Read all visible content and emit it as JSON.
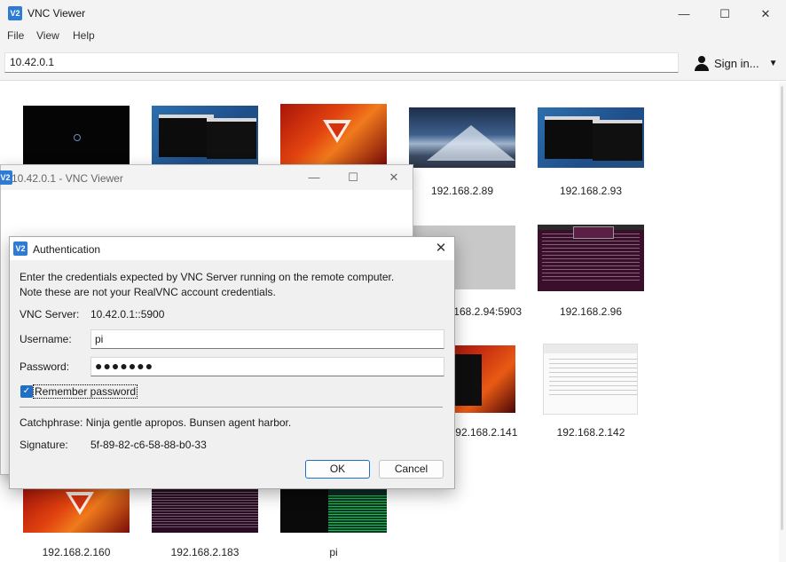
{
  "main_window": {
    "title": "VNC Viewer",
    "logo": "V2",
    "controls": {
      "minimize": "—",
      "maximize": "☐",
      "close": "✕"
    }
  },
  "menu": [
    "File",
    "View",
    "Help"
  ],
  "toolbar": {
    "address": "10.42.0.1",
    "signin_label": "Sign in...",
    "user_icon": "user-icon",
    "caret": "▼"
  },
  "computers": [
    {
      "label": "",
      "style": "t-black"
    },
    {
      "label": "",
      "style": "t-term"
    },
    {
      "label": "",
      "style": "t-red"
    },
    {
      "label": "192.168.2.89",
      "style": "t-mtn"
    },
    {
      "label": "192.168.2.93",
      "style": "t-term"
    },
    {
      "label": "192.168.2.94:5903",
      "style": "t-grey"
    },
    {
      "label": "192.168.2.96",
      "style": "t-purple"
    },
    {
      "label": "192.168.2.141",
      "style": "t-redterm"
    },
    {
      "label": "192.168.2.142",
      "style": "t-white"
    },
    {
      "label": "192.168.2.160",
      "style": "t-red"
    },
    {
      "label": "192.168.2.183",
      "style": "t-purple2"
    },
    {
      "label": "pi",
      "style": "t-dark"
    }
  ],
  "session_window": {
    "title": "10.42.0.1 - VNC Viewer",
    "controls": {
      "minimize": "—",
      "maximize": "☐",
      "close": "✕"
    }
  },
  "auth": {
    "title": "Authentication",
    "close": "✕",
    "message_line1": "Enter the credentials expected by VNC Server running on the remote computer.",
    "message_line2": "Note these are not your RealVNC account credentials.",
    "server_label": "VNC Server:",
    "server_value": "10.42.0.1::5900",
    "username_label": "Username:",
    "username_value": "pi",
    "password_label": "Password:",
    "password_value": "●●●●●●●",
    "remember_label": "Remember password",
    "remember_checked": true,
    "checkmark": "✓",
    "catchphrase": "Catchphrase: Ninja gentle apropos. Bunsen agent harbor.",
    "signature_label": "Signature:",
    "signature_value": "5f-89-82-c6-58-88-b0-33",
    "ok_label": "OK",
    "cancel_label": "Cancel"
  }
}
